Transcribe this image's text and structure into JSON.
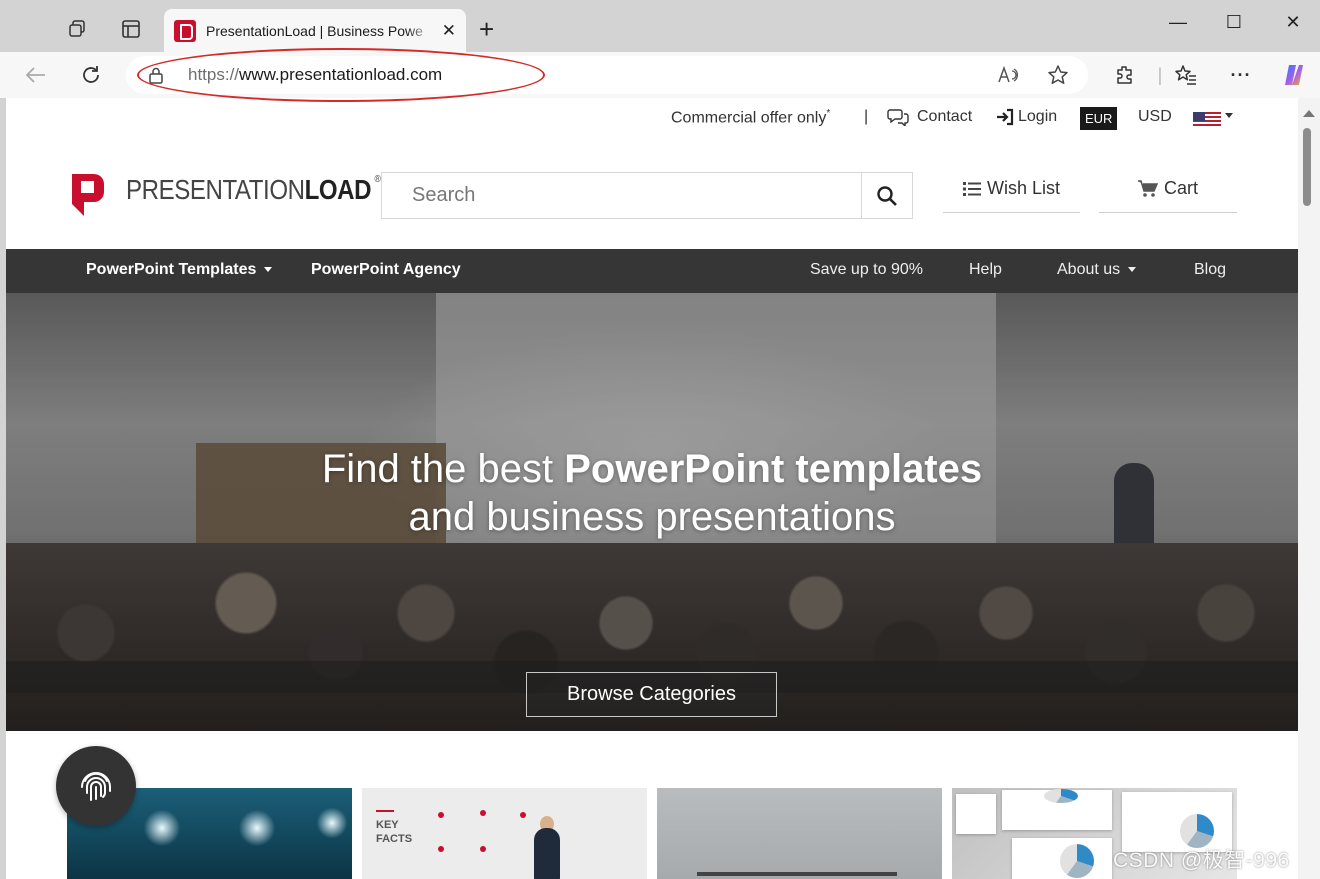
{
  "browser": {
    "tab_title": "PresentationLoad | Business Powe",
    "url_scheme": "https://",
    "url_host": "www.presentationload.com",
    "new_tab_glyph": "+",
    "tab_close_glyph": "✕",
    "window_controls": {
      "minimize": "—",
      "maximize": "☐",
      "close": "✕"
    },
    "annotation_color": "#d42a2a"
  },
  "topbar": {
    "commercial": "Commercial offer only",
    "commercial_mark": "*",
    "separator": "|",
    "contact": "Contact",
    "login": "Login",
    "currency_active": "EUR",
    "currency_other": "USD"
  },
  "header": {
    "logo_text_light": "PRESENTATION",
    "logo_text_bold": "LOAD",
    "logo_reg": "®",
    "search_placeholder": "Search",
    "wishlist": "Wish List",
    "cart": "Cart"
  },
  "nav": {
    "items": [
      {
        "label": "PowerPoint Templates",
        "has_dropdown": true
      },
      {
        "label": "PowerPoint Agency",
        "has_dropdown": false
      },
      {
        "label": "Save up to 90%",
        "has_dropdown": false
      },
      {
        "label": "Help",
        "has_dropdown": false
      },
      {
        "label": "About us",
        "has_dropdown": true
      },
      {
        "label": "Blog",
        "has_dropdown": false
      }
    ]
  },
  "hero": {
    "line1_normal": "Find the best ",
    "line1_bold": "PowerPoint templates",
    "line2": "and business presentations",
    "browse_button": "Browse Categories"
  },
  "thumbnails": {
    "card2_text_line1": "KEY",
    "card2_text_line2": "FACTS"
  },
  "watermark": "CSDN @极智-996",
  "colors": {
    "brand_red": "#c8102e",
    "nav_bg": "#363636",
    "text": "#333333"
  }
}
